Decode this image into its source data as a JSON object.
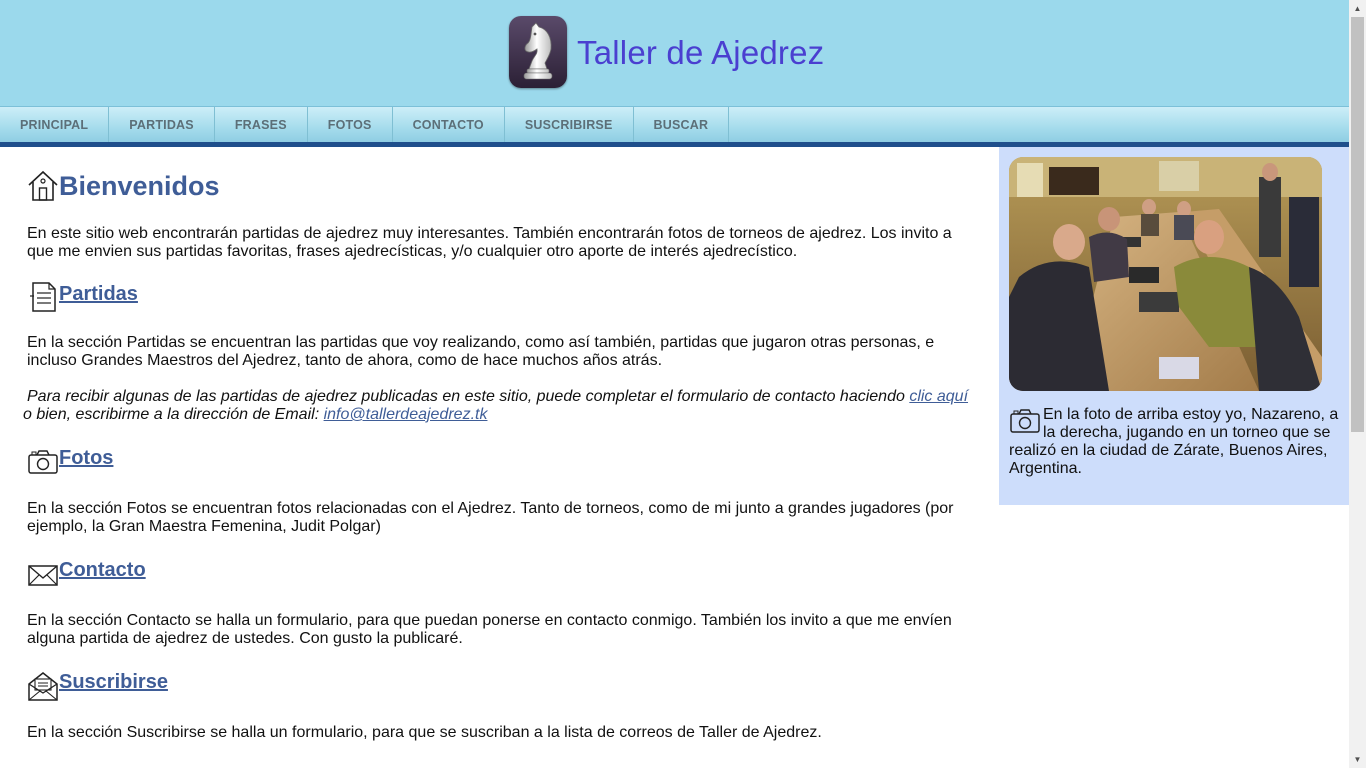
{
  "header": {
    "title": "Taller de Ajedrez"
  },
  "nav": {
    "items": [
      {
        "label": "PRINCIPAL"
      },
      {
        "label": "PARTIDAS"
      },
      {
        "label": "FRASES"
      },
      {
        "label": "FOTOS"
      },
      {
        "label": "CONTACTO"
      },
      {
        "label": "SUSCRIBIRSE"
      },
      {
        "label": "BUSCAR"
      }
    ]
  },
  "welcome": {
    "title": "Bienvenidos",
    "text": "En este sitio web encontrarán partidas de ajedrez muy interesantes. También encontrarán fotos de torneos de ajedrez. Los invito a que me envien sus partidas favoritas, frases ajedrecísticas, y/o cualquier otro aporte de interés ajedrecístico."
  },
  "partidas": {
    "title": "Partidas",
    "text": "En la sección Partidas se encuentran las partidas que voy realizando, como así también, partidas que jugaron otras personas, e incluso Grandes Maestros del Ajedrez, tanto de ahora, como de hace muchos años atrás.",
    "note_prefix": "Para recibir algunas de las partidas de ajedrez publicadas en este sitio, puede completar el formulario de contacto haciendo ",
    "note_link": "clic aquí",
    "note_middle": " o bien, escribirme a la dirección de Email: ",
    "email": "info@tallerdeajedrez.tk"
  },
  "fotos": {
    "title": "Fotos",
    "text": "En la sección Fotos se encuentran fotos relacionadas con el Ajedrez. Tanto de torneos, como de mi junto a grandes jugadores (por ejemplo, la Gran Maestra Femenina, Judit Polgar)"
  },
  "contacto": {
    "title": "Contacto",
    "text": "En la sección Contacto se halla un formulario, para que puedan ponerse en contacto conmigo. También los invito a que me envíen alguna partida de ajedrez de ustedes. Con gusto la publicaré."
  },
  "suscribirse": {
    "title": "Suscribirse",
    "text": "En la sección Suscribirse se halla un formulario, para que se suscriban a la lista de correos de Taller de Ajedrez."
  },
  "sidebar": {
    "caption": "En la foto de arriba estoy yo, Nazareno, a la derecha, jugando en un torneo que se realizó en la ciudad de Zárate, Buenos Aires, Argentina."
  },
  "colors": {
    "header_bg": "#9bd9ec",
    "accent": "#3f5d97",
    "sidebar_bg": "#cdddfb",
    "nav_bar": "#1f4f8c"
  },
  "icons": {
    "logo": "chess-knight-icon",
    "welcome": "house-icon",
    "partidas": "document-icon",
    "fotos": "camera-icon",
    "contacto": "envelope-icon",
    "suscribirse": "envelope-open-icon"
  }
}
